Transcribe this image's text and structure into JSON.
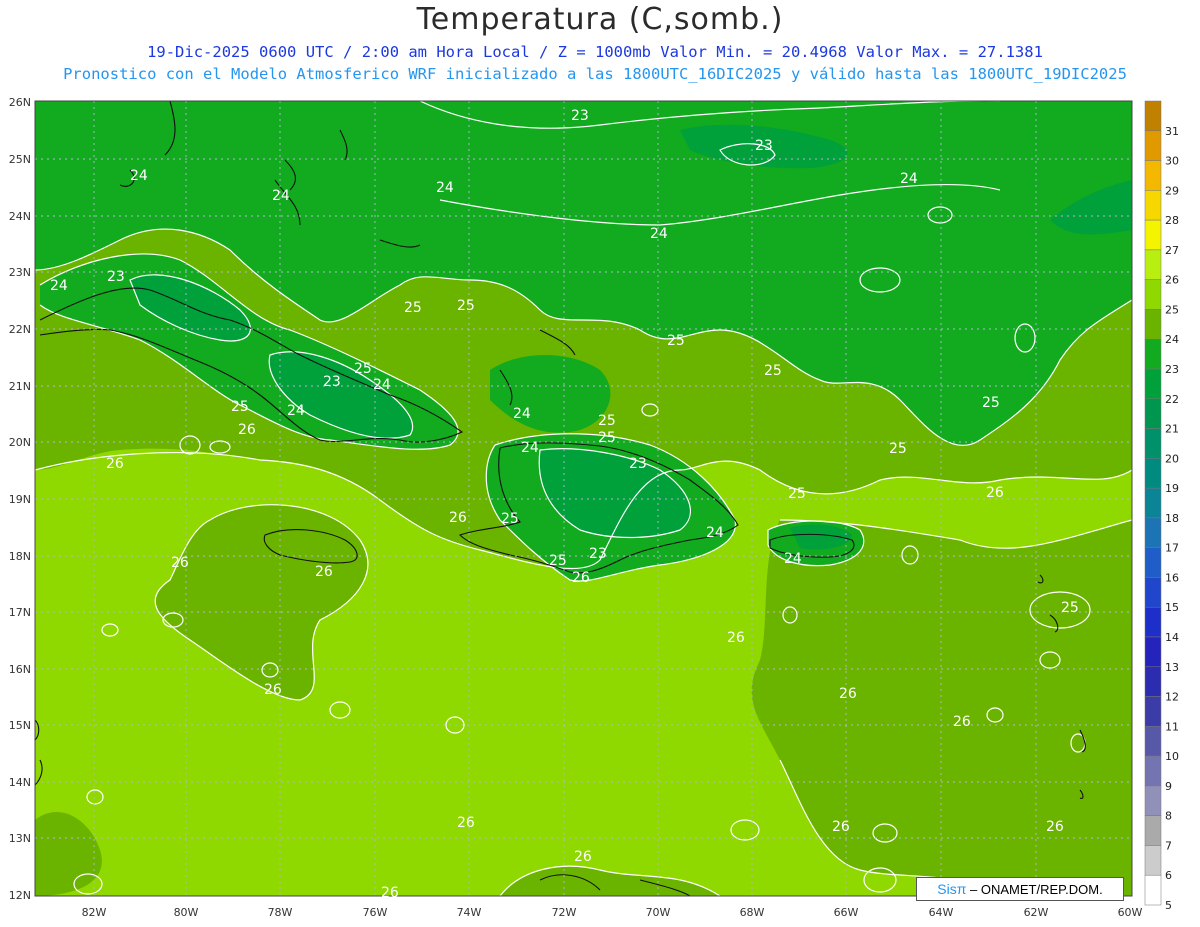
{
  "header": {
    "title": "Temperatura (C,somb.)",
    "subtitle_line1": "19-Dic-2025  0600 UTC / 2:00 am Hora Local / Z = 1000mb   Valor Min. = 20.4968  Valor Max. = 27.1381",
    "subtitle_line2": "Pronostico con el Modelo Atmosferico WRF inicializado a las 1800UTC_16DIC2025 y válido hasta las  1800UTC_19DIC2025"
  },
  "map": {
    "lat_labels": [
      "26N",
      "25N",
      "24N",
      "23N",
      "22N",
      "21N",
      "20N",
      "19N",
      "18N",
      "17N",
      "16N",
      "15N",
      "14N",
      "13N",
      "12N"
    ],
    "lon_labels": [
      "82W",
      "80W",
      "78W",
      "76W",
      "74W",
      "72W",
      "70W",
      "68W",
      "66W",
      "64W",
      "62W",
      "60W"
    ],
    "contour_labels": [
      "23",
      "23",
      "24",
      "24",
      "24",
      "24",
      "24",
      "23",
      "24",
      "25",
      "25",
      "25",
      "25",
      "24",
      "23",
      "25",
      "24",
      "25",
      "26",
      "26",
      "24",
      "25",
      "25",
      "25",
      "24",
      "25",
      "23",
      "25",
      "26",
      "26",
      "25",
      "24",
      "23",
      "25",
      "24",
      "26",
      "26",
      "26",
      "26",
      "26",
      "26",
      "26",
      "26",
      "26",
      "25",
      "25",
      "26",
      "26",
      "26",
      "26"
    ]
  },
  "colorbar": {
    "labels": [
      "31",
      "30",
      "29",
      "28",
      "27",
      "26",
      "25",
      "24",
      "23",
      "22",
      "21",
      "20",
      "19",
      "18",
      "17",
      "16",
      "15",
      "14",
      "13",
      "12",
      "11",
      "10",
      "9",
      "8",
      "7",
      "6",
      "5"
    ],
    "colors": [
      "#c08000",
      "#e09a00",
      "#f4b800",
      "#f6d800",
      "#f4f400",
      "#b8ee10",
      "#8fd800",
      "#6ab400",
      "#12aa1e",
      "#00a03a",
      "#00964f",
      "#00906a",
      "#008a80",
      "#0b8496",
      "#1c74b4",
      "#1f5ec8",
      "#2046cc",
      "#1e2ec8",
      "#2424bc",
      "#2c2cb0",
      "#3c3ca8",
      "#5858a8",
      "#7474b0",
      "#9090b8",
      "#aaaaaa",
      "#cccccc",
      "#ffffff"
    ]
  },
  "credit": {
    "logo": "Sisπ",
    "text": " –  ONAMET/REP.DOM."
  }
}
